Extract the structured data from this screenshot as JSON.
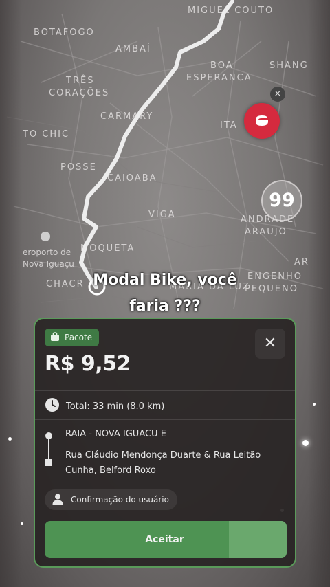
{
  "map": {
    "labels": [
      "MIGUEL COUTO",
      "BOTAFOGO",
      "AMBAÍ",
      "TRÊS",
      "CORAÇÕES",
      "BOA",
      "ESPERANÇA",
      "SHANG",
      "CARMARY",
      "TO CHIC",
      "ITA",
      "POSSE",
      "CAIOABA",
      "VIGA",
      "ANDRADE",
      "ARAUJO",
      "eroporto de",
      "Nova Iguaçu",
      "MOQUETA",
      "CHACR",
      "MARIA DA LUZ",
      "ENGENHO",
      "PEQUENO",
      "AR"
    ],
    "badge_99": "99",
    "close_glyph": "×"
  },
  "caption": {
    "line1": "Modal Bike, você",
    "line2": "faria ???"
  },
  "card": {
    "tag": "Pacote",
    "close": "✕",
    "price": "R$ 9,52",
    "total": "Total: 33 min (8.0 km)",
    "pickup": "RAIA - NOVA IGUACU E",
    "dropoff": "Rua Cláudio Mendonça Duarte & Rua Leitão Cunha, Belford Roxo",
    "confirmation": "Confirmação do usuário",
    "accept": "Aceitar",
    "accept_progress_percent": 76
  },
  "colors": {
    "accent_green": "#4e9353",
    "brand_red": "#d52a3e",
    "border_green": "#5a9a5a"
  },
  "icons": [
    "bag-icon",
    "close-icon",
    "clock-icon",
    "route-icon",
    "user-icon",
    "badge-99-icon",
    "app-logo-icon"
  ]
}
